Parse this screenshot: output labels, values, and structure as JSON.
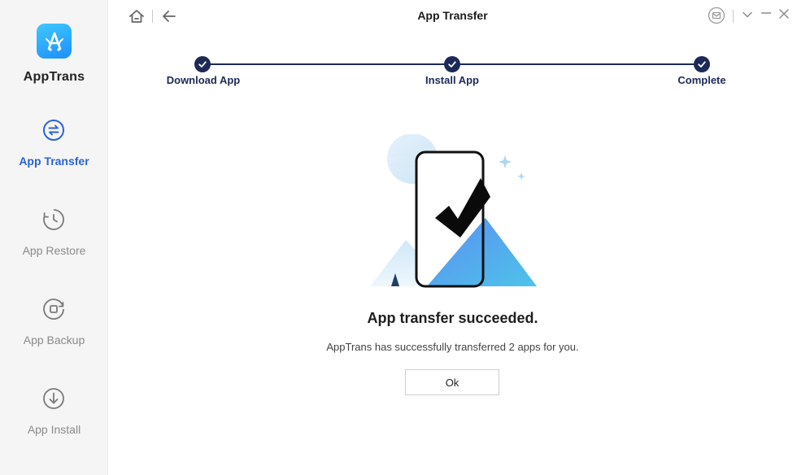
{
  "app": {
    "name": "AppTrans",
    "logo_icon": "app-store-icon",
    "accent": "#2a63d6"
  },
  "sidebar": {
    "items": [
      {
        "label": "App Transfer",
        "icon": "transfer-arrows-icon",
        "active": true
      },
      {
        "label": "App Restore",
        "icon": "clock-restore-icon",
        "active": false
      },
      {
        "label": "App Backup",
        "icon": "backup-icon",
        "active": false
      },
      {
        "label": "App Install",
        "icon": "download-icon",
        "active": false
      }
    ]
  },
  "topbar": {
    "title": "App Transfer",
    "left_icons": [
      "home-icon",
      "back-arrow-icon"
    ],
    "right_icons": [
      "mail-icon",
      "chevron-down-icon",
      "minimize-icon",
      "close-icon"
    ]
  },
  "stepper": {
    "color": "#1d2a58",
    "steps": [
      {
        "label": "Download App",
        "done": true
      },
      {
        "label": "Install App",
        "done": true
      },
      {
        "label": "Complete",
        "done": true
      }
    ]
  },
  "result": {
    "illustration": "phone-checkmark-illustration",
    "headline": "App transfer succeeded.",
    "message": "AppTrans has successfully transferred 2 apps for you.",
    "ok_label": "Ok"
  }
}
